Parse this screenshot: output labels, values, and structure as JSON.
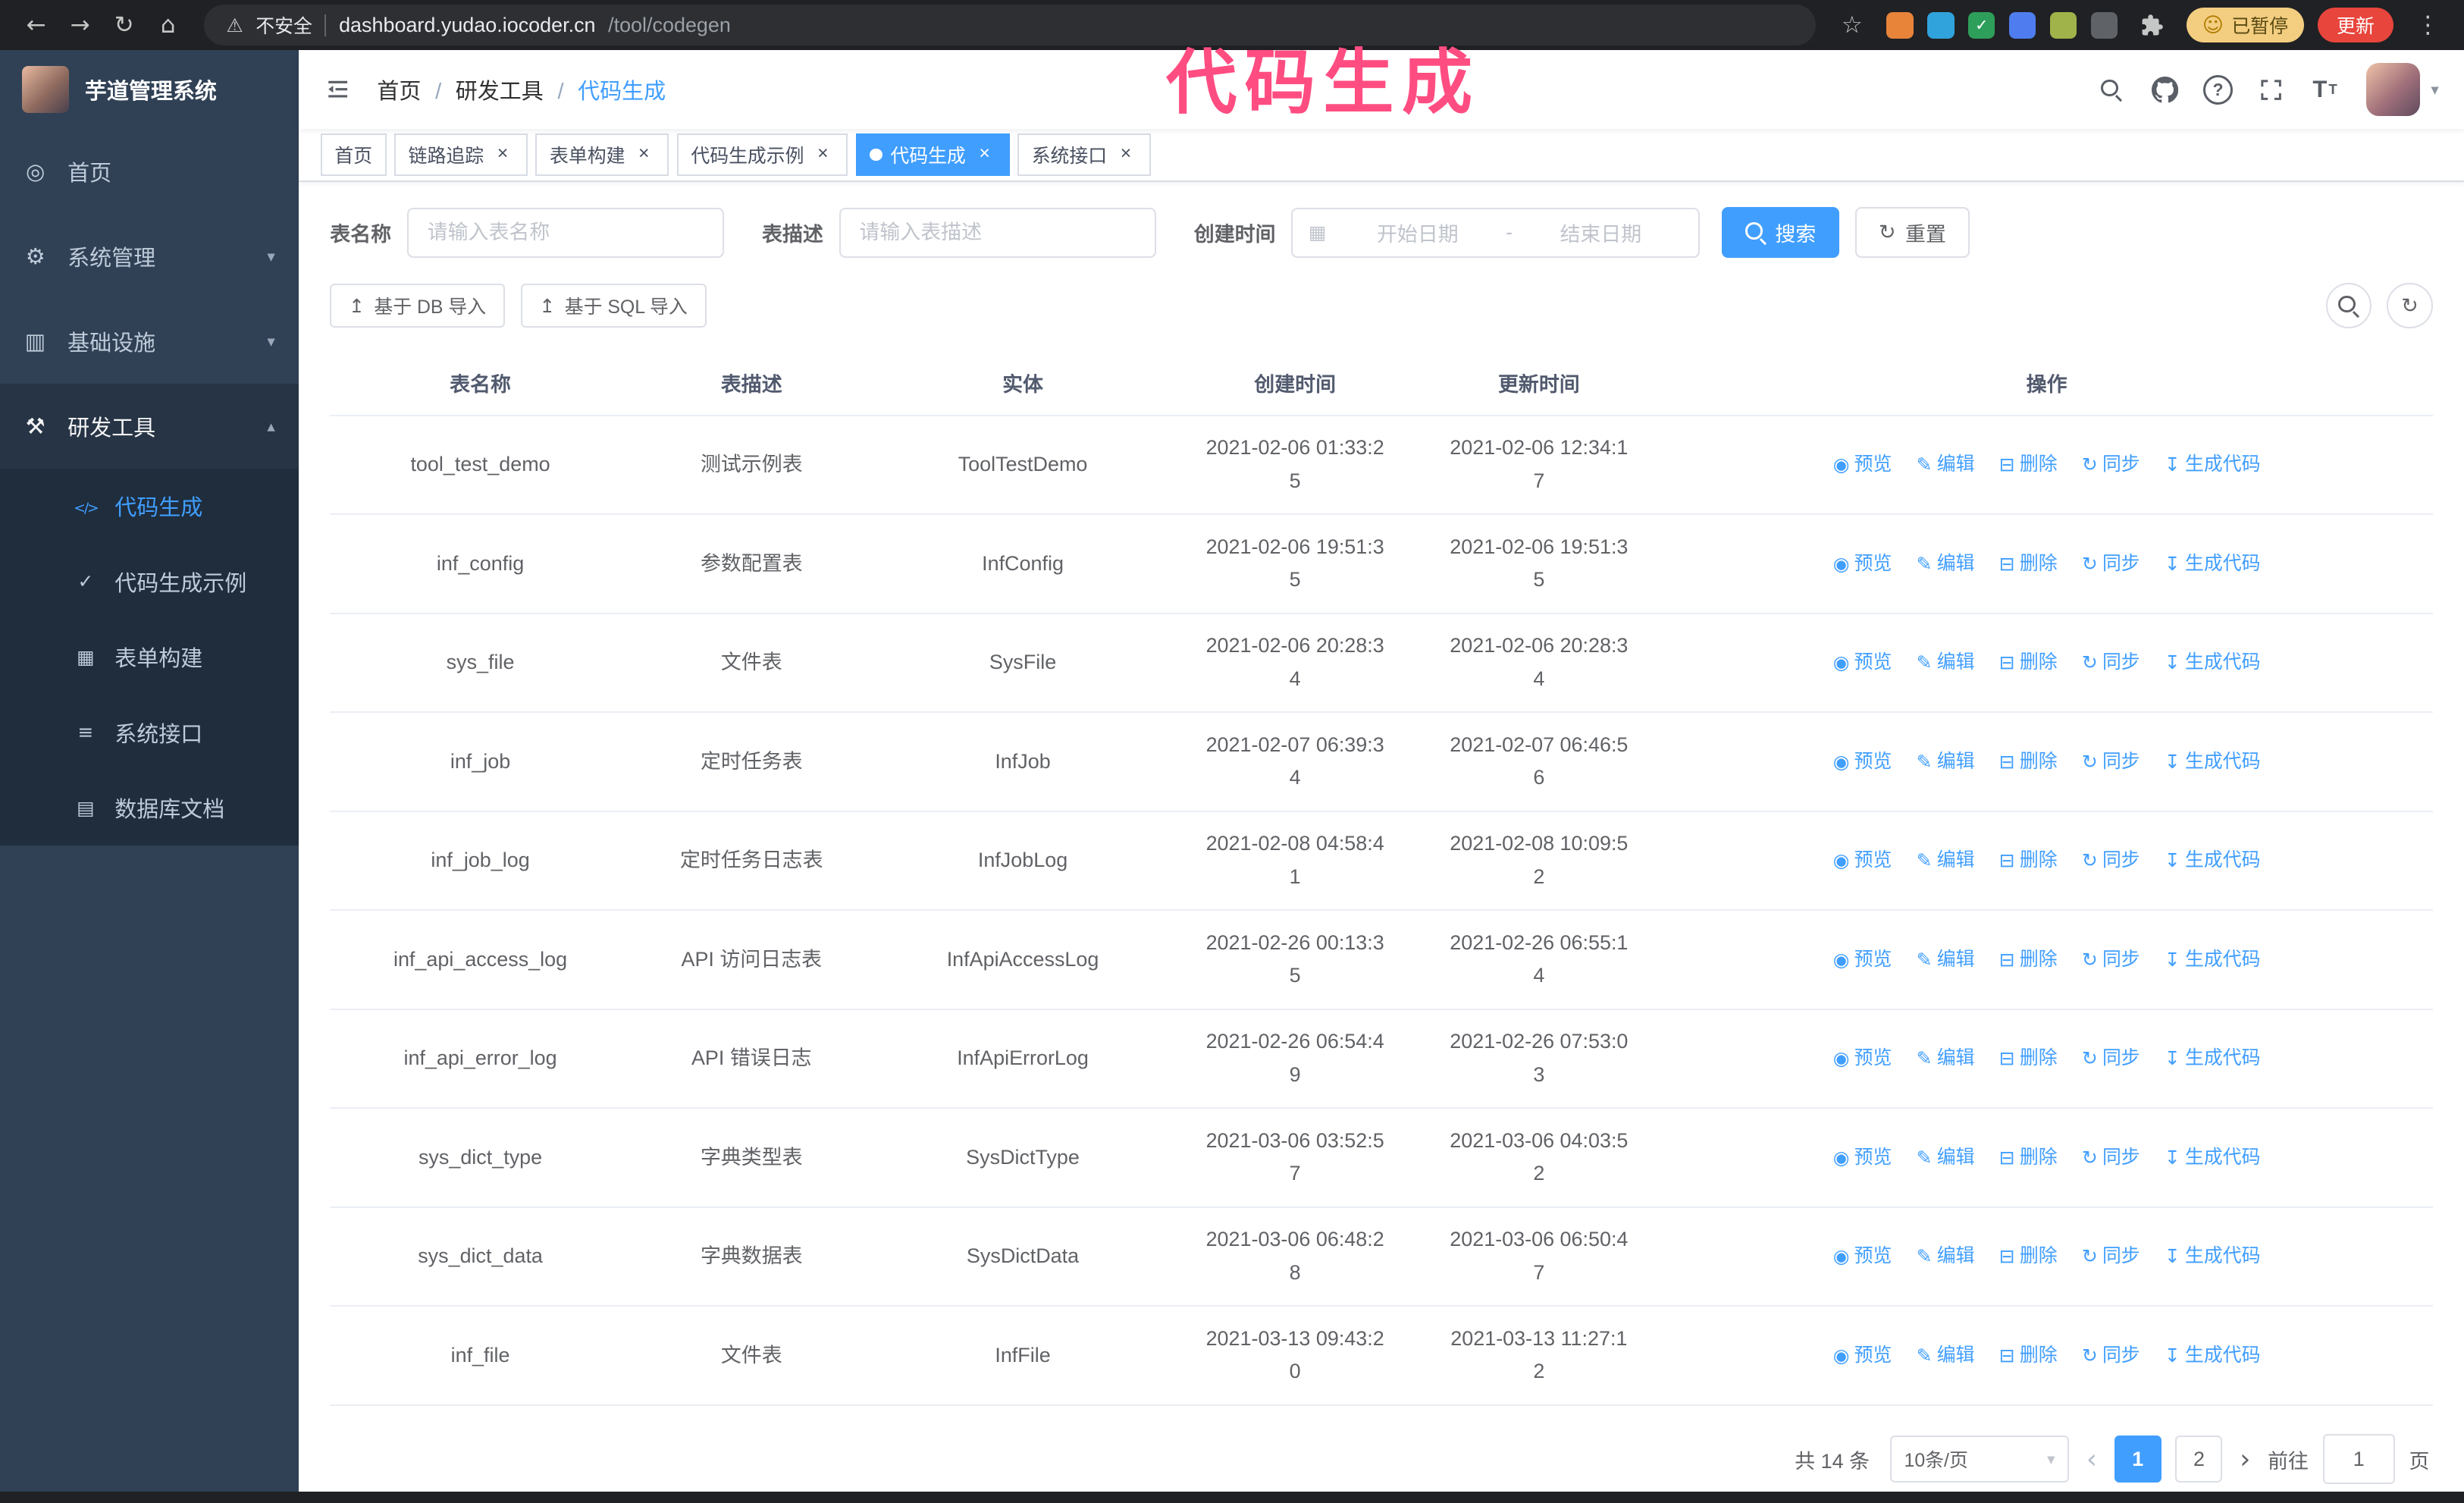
{
  "colors": {
    "primary": "#409eff",
    "sidebar_bg": "#304156",
    "submenu_bg": "#1f2d3d",
    "annotation_pink": "#ff4d82",
    "update_button_red": "#e8453c",
    "paused_badge_tan": "#f3cd80"
  },
  "browser": {
    "security_label": "不安全",
    "url_host": "dashboard.yudao.iocoder.cn",
    "url_path": "/tool/codegen",
    "paused_badge": "已暂停",
    "update_button": "更新",
    "extensions": [
      {
        "name": "extension-orange",
        "color": "#e8833a",
        "glyph": ""
      },
      {
        "name": "extension-blue",
        "color": "#30a3dc",
        "glyph": ""
      },
      {
        "name": "extension-green-check",
        "color": "#2e9e5b",
        "glyph": "✓"
      },
      {
        "name": "extension-people",
        "color": "#4f7df0",
        "glyph": ""
      },
      {
        "name": "extension-olive",
        "color": "#9fb34a",
        "glyph": ""
      },
      {
        "name": "extension-dark",
        "color": "#5f6368",
        "glyph": ""
      }
    ]
  },
  "annotation": {
    "text": "代码生成"
  },
  "sidebar": {
    "logo_title": "芋道管理系统",
    "items": [
      {
        "label": "首页",
        "icon": "dashboard"
      },
      {
        "label": "系统管理",
        "icon": "gear",
        "chevron": "chevron-down"
      },
      {
        "label": "基础设施",
        "icon": "infrastructure",
        "chevron": "chevron-down"
      },
      {
        "label": "研发工具",
        "icon": "tools",
        "chevron": "chevron-up",
        "active": true
      }
    ],
    "subitems": [
      {
        "label": "代码生成",
        "icon": "code",
        "active": true
      },
      {
        "label": "代码生成示例",
        "icon": "example"
      },
      {
        "label": "表单构建",
        "icon": "form-builder"
      },
      {
        "label": "系统接口",
        "icon": "api"
      },
      {
        "label": "数据库文档",
        "icon": "database-doc"
      }
    ]
  },
  "header": {
    "breadcrumb": [
      {
        "label": "首页"
      },
      {
        "label": "研发工具"
      },
      {
        "label": "代码生成",
        "current": true
      }
    ]
  },
  "tabs": [
    {
      "label": "首页"
    },
    {
      "label": "链路追踪",
      "closable": true
    },
    {
      "label": "表单构建",
      "closable": true
    },
    {
      "label": "代码生成示例",
      "closable": true
    },
    {
      "label": "代码生成",
      "closable": true,
      "active": true
    },
    {
      "label": "系统接口",
      "closable": true
    }
  ],
  "filters": {
    "table_name_label": "表名称",
    "table_name_placeholder": "请输入表名称",
    "table_desc_label": "表描述",
    "table_desc_placeholder": "请输入表描述",
    "create_time_label": "创建时间",
    "date_start_placeholder": "开始日期",
    "date_separator": "-",
    "date_end_placeholder": "结束日期",
    "search_button": "搜索",
    "reset_button": "重置"
  },
  "toolbar": {
    "import_db": "基于 DB 导入",
    "import_sql": "基于 SQL 导入"
  },
  "table": {
    "columns": [
      "表名称",
      "表描述",
      "实体",
      "创建时间",
      "更新时间",
      "操作"
    ],
    "actions": [
      {
        "label": "预览",
        "icon": "eye"
      },
      {
        "label": "编辑",
        "icon": "edit"
      },
      {
        "label": "删除",
        "icon": "trash"
      },
      {
        "label": "同步",
        "icon": "sync"
      },
      {
        "label": "生成代码",
        "icon": "download"
      }
    ],
    "rows": [
      {
        "name": "tool_test_demo",
        "desc": "测试示例表",
        "entity": "ToolTestDemo",
        "created": "2021-02-06 01:33:25",
        "updated": "2021-02-06 12:34:17"
      },
      {
        "name": "inf_config",
        "desc": "参数配置表",
        "entity": "InfConfig",
        "created": "2021-02-06 19:51:35",
        "updated": "2021-02-06 19:51:35"
      },
      {
        "name": "sys_file",
        "desc": "文件表",
        "entity": "SysFile",
        "created": "2021-02-06 20:28:34",
        "updated": "2021-02-06 20:28:34"
      },
      {
        "name": "inf_job",
        "desc": "定时任务表",
        "entity": "InfJob",
        "created": "2021-02-07 06:39:34",
        "updated": "2021-02-07 06:46:56"
      },
      {
        "name": "inf_job_log",
        "desc": "定时任务日志表",
        "entity": "InfJobLog",
        "created": "2021-02-08 04:58:41",
        "updated": "2021-02-08 10:09:52"
      },
      {
        "name": "inf_api_access_log",
        "desc": "API 访问日志表",
        "entity": "InfApiAccessLog",
        "created": "2021-02-26 00:13:35",
        "updated": "2021-02-26 06:55:14"
      },
      {
        "name": "inf_api_error_log",
        "desc": "API 错误日志",
        "entity": "InfApiErrorLog",
        "created": "2021-02-26 06:54:49",
        "updated": "2021-02-26 07:53:03"
      },
      {
        "name": "sys_dict_type",
        "desc": "字典类型表",
        "entity": "SysDictType",
        "created": "2021-03-06 03:52:57",
        "updated": "2021-03-06 04:03:52"
      },
      {
        "name": "sys_dict_data",
        "desc": "字典数据表",
        "entity": "SysDictData",
        "created": "2021-03-06 06:48:28",
        "updated": "2021-03-06 06:50:47"
      },
      {
        "name": "inf_file",
        "desc": "文件表",
        "entity": "InfFile",
        "created": "2021-03-13 09:43:20",
        "updated": "2021-03-13 11:27:12"
      }
    ]
  },
  "pagination": {
    "total_text": "共 14 条",
    "page_size": "10条/页",
    "pages": [
      {
        "label": "1",
        "active": true
      },
      {
        "label": "2"
      }
    ],
    "goto_label": "前往",
    "goto_value": "1",
    "goto_suffix": "页"
  }
}
